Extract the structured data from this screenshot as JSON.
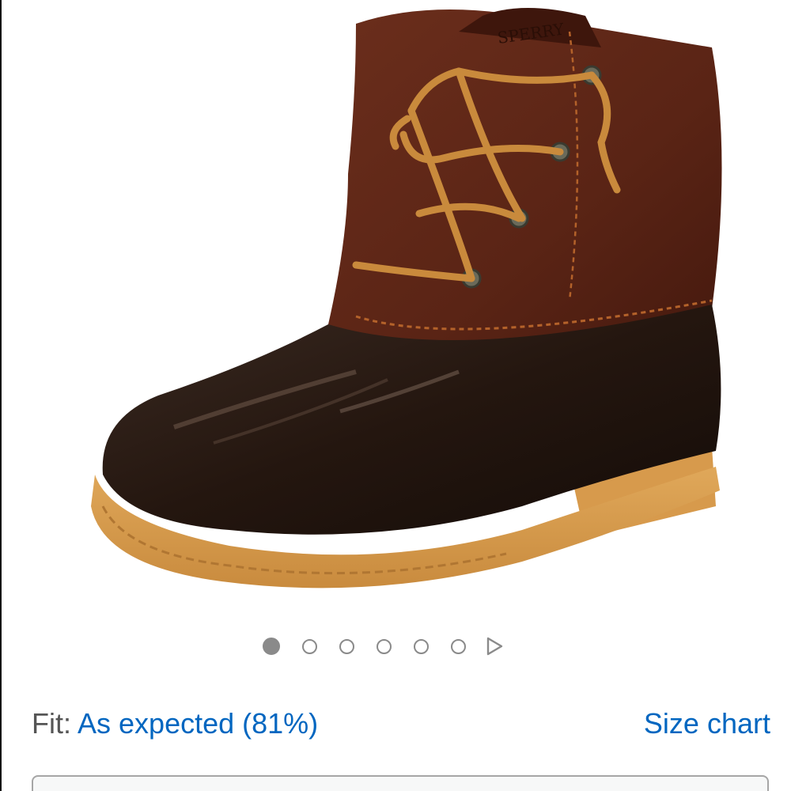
{
  "product_image": {
    "alt_icon": "duck-boot-image",
    "brand_stamp": "SPERRY"
  },
  "carousel": {
    "total_images": 6,
    "active_index": 0,
    "play_icon": "play-triangle-icon"
  },
  "fit": {
    "label": "Fit:",
    "value": "As expected (81%)"
  },
  "size_chart": {
    "label": "Size chart"
  },
  "colors": {
    "link": "#0066c0",
    "label": "#555555",
    "dot": "#8a8a8a"
  }
}
